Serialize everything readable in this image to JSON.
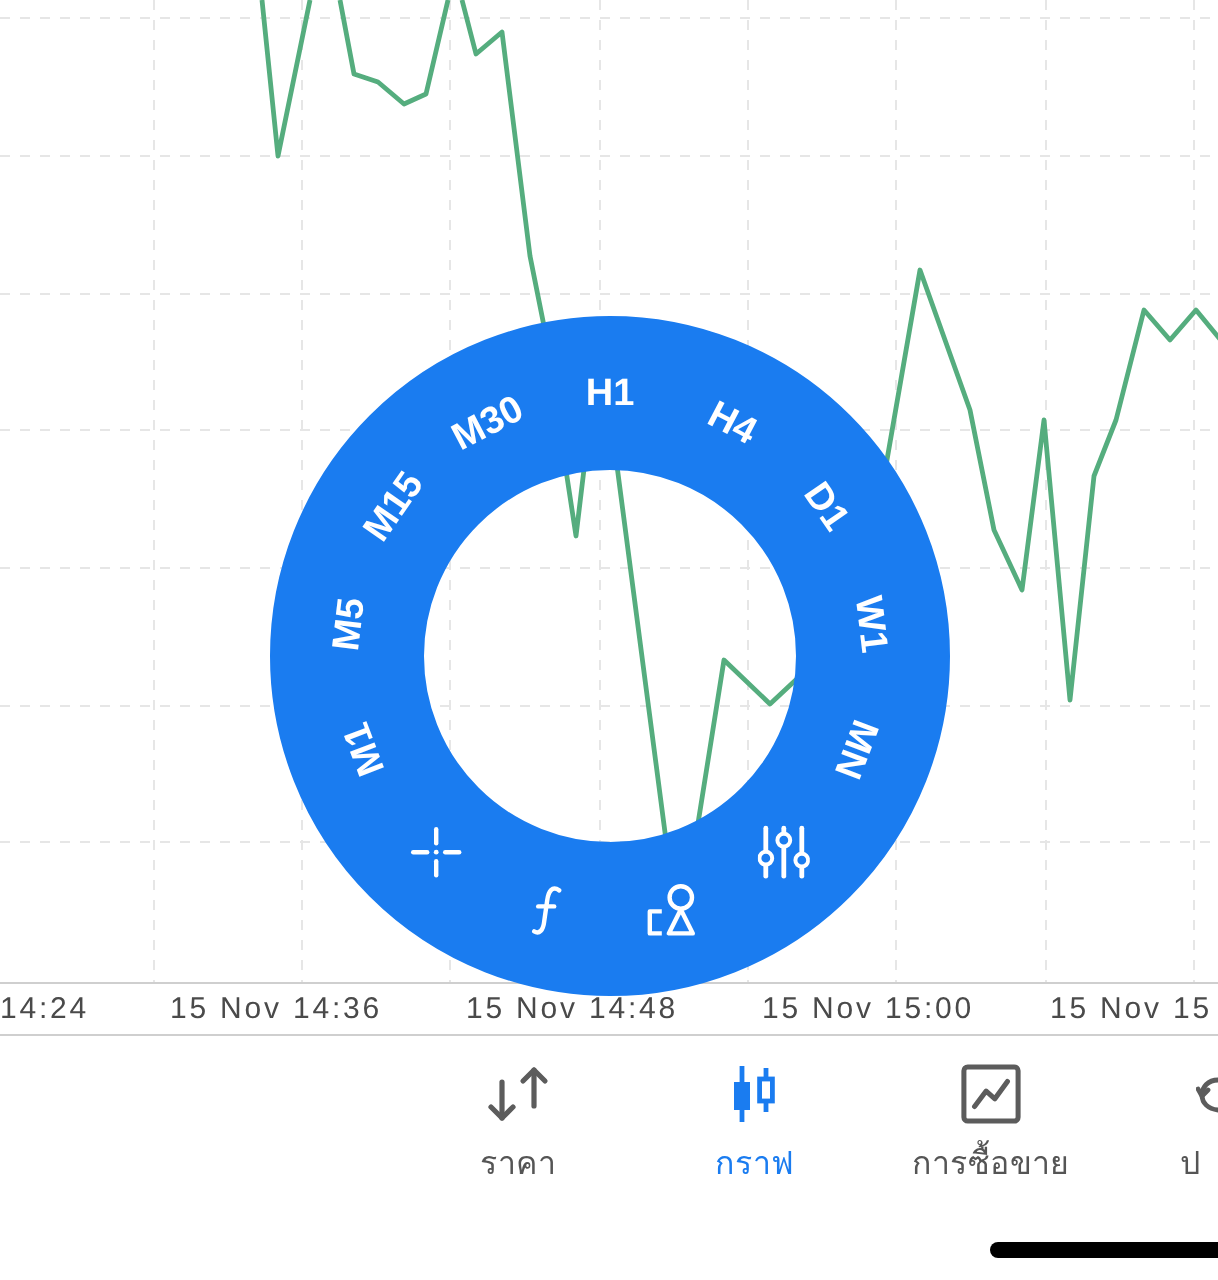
{
  "chart": {
    "x_axis_labels": [
      "14:24",
      "15 Nov 14:36",
      "15 Nov 14:48",
      "15 Nov 15:00",
      "15 Nov 15"
    ]
  },
  "timeframe_wheel": {
    "timeframes": [
      "M1",
      "M5",
      "M15",
      "M30",
      "H1",
      "H4",
      "D1",
      "W1",
      "MN"
    ]
  },
  "tab_bar": {
    "tabs": [
      {
        "label": "ราคา",
        "selected": false,
        "kind": "quotes"
      },
      {
        "label": "กราฟ",
        "selected": true,
        "kind": "chart"
      },
      {
        "label": "การซื้อขาย",
        "selected": false,
        "kind": "trade"
      },
      {
        "label": "ป",
        "selected": false,
        "kind": "history"
      }
    ]
  }
}
